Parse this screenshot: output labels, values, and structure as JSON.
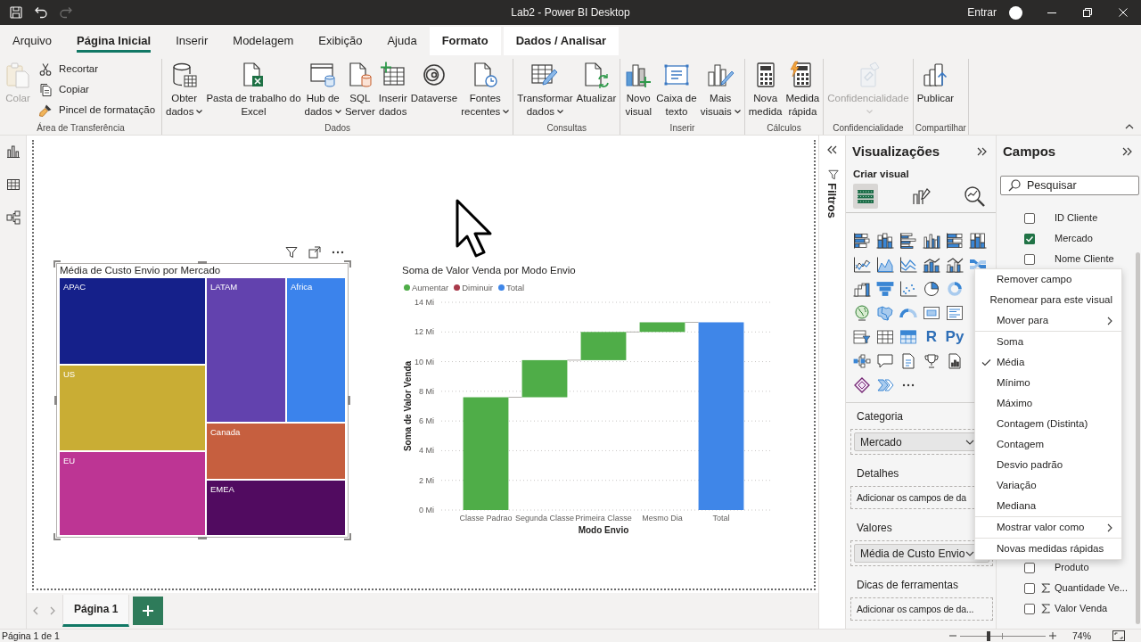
{
  "window": {
    "title": "Lab2 - Power BI Desktop",
    "sign_in": "Entrar"
  },
  "quick_access": [
    {
      "disabled": false
    },
    {
      "disabled": false
    },
    {
      "disabled": true
    }
  ],
  "menu_tabs": [
    {
      "label": "Arquivo",
      "kind": "plain",
      "selected": false
    },
    {
      "label": "Página Inicial",
      "kind": "plain",
      "selected": true
    },
    {
      "label": "Inserir",
      "kind": "plain",
      "selected": false
    },
    {
      "label": "Modelagem",
      "kind": "plain",
      "selected": false
    },
    {
      "label": "Exibição",
      "kind": "plain",
      "selected": false
    },
    {
      "label": "Ajuda",
      "kind": "plain",
      "selected": false
    },
    {
      "label": "Formato",
      "kind": "contextual",
      "selected": false
    },
    {
      "label": "Dados / Analisar",
      "kind": "contextual",
      "selected": false
    }
  ],
  "ribbon": {
    "groups": [
      {
        "label": "Área de Transferência",
        "buttons": [
          {
            "kind": "large",
            "lines": [
              "Colar"
            ],
            "dropdown": false,
            "disabled": true
          },
          {
            "kind": "small",
            "lines": [
              "Recortar"
            ],
            "dropdown": false,
            "disabled": false
          },
          {
            "kind": "small",
            "lines": [
              "Copiar"
            ],
            "dropdown": false,
            "disabled": false
          },
          {
            "kind": "small",
            "lines": [
              "Pincel de formatação"
            ],
            "dropdown": false,
            "disabled": false
          }
        ]
      },
      {
        "label": "Dados",
        "buttons": [
          {
            "kind": "large",
            "lines": [
              "Obter",
              "dados"
            ],
            "dropdown": true,
            "disabled": false
          },
          {
            "kind": "large",
            "lines": [
              "Pasta de trabalho do",
              "Excel"
            ],
            "dropdown": false,
            "disabled": false
          },
          {
            "kind": "large",
            "lines": [
              "Hub de",
              "dados"
            ],
            "dropdown": true,
            "disabled": false
          },
          {
            "kind": "large",
            "lines": [
              "SQL",
              "Server"
            ],
            "dropdown": false,
            "disabled": false
          },
          {
            "kind": "large",
            "lines": [
              "Inserir",
              "dados"
            ],
            "dropdown": false,
            "disabled": false
          },
          {
            "kind": "large",
            "lines": [
              "Dataverse"
            ],
            "dropdown": false,
            "disabled": false
          },
          {
            "kind": "large",
            "lines": [
              "Fontes",
              "recentes"
            ],
            "dropdown": true,
            "disabled": false
          }
        ]
      },
      {
        "label": "Consultas",
        "buttons": [
          {
            "kind": "large",
            "lines": [
              "Transformar",
              "dados"
            ],
            "dropdown": true,
            "disabled": false
          },
          {
            "kind": "large",
            "lines": [
              "Atualizar"
            ],
            "dropdown": false,
            "disabled": false
          }
        ]
      },
      {
        "label": "Inserir",
        "buttons": [
          {
            "kind": "large",
            "lines": [
              "Novo",
              "visual"
            ],
            "dropdown": false,
            "disabled": false
          },
          {
            "kind": "large",
            "lines": [
              "Caixa de",
              "texto"
            ],
            "dropdown": false,
            "disabled": false
          },
          {
            "kind": "large",
            "lines": [
              "Mais",
              "visuais"
            ],
            "dropdown": true,
            "disabled": false
          }
        ]
      },
      {
        "label": "Cálculos",
        "buttons": [
          {
            "kind": "large",
            "lines": [
              "Nova",
              "medida"
            ],
            "dropdown": false,
            "disabled": false
          },
          {
            "kind": "large",
            "lines": [
              "Medida",
              "rápida"
            ],
            "dropdown": false,
            "disabled": false
          }
        ]
      },
      {
        "label": "Confidencialidade",
        "buttons": [
          {
            "kind": "large",
            "lines": [
              "Confidencialidade"
            ],
            "dropdown": true,
            "disabled": true
          }
        ]
      },
      {
        "label": "Compartilhar",
        "buttons": [
          {
            "kind": "large",
            "lines": [
              "Publicar"
            ],
            "dropdown": false,
            "disabled": false
          }
        ]
      }
    ]
  },
  "report": {
    "visuals": [
      {
        "kind": "treemap",
        "selected": true,
        "title": "Média de Custo Envio por Mercado",
        "tiles": [
          {
            "label": "APAC",
            "color": "#15208a"
          },
          {
            "label": "US",
            "color": "#c9ad34"
          },
          {
            "label": "EU",
            "color": "#bd3594"
          },
          {
            "label": "LATAM",
            "color": "#6242ae"
          },
          {
            "label": "Africa",
            "color": "#3b83ec"
          },
          {
            "label": "Canada",
            "color": "#c65f3f"
          },
          {
            "label": "EMEA",
            "color": "#510b60"
          }
        ]
      },
      {
        "kind": "waterfall",
        "selected": false,
        "chart_data": {
          "type": "candlestick",
          "title": "Soma de Valor Venda por Modo Envio",
          "xlabel": "Modo Envio",
          "ylabel": "Soma de Valor Venda",
          "categories": [
            "Classe Padrao",
            "Segunda Classe",
            "Primeira Classe",
            "Mesmo Dia",
            "Total"
          ],
          "grid": true,
          "series": [
            {
              "name": "Aumentar",
              "color": "#4fad48",
              "ohlc": [
                [
                  0,
                  7.6,
                  0,
                  7.6
                ],
                [
                  7.6,
                  10.1,
                  7.6,
                  10.1
                ],
                [
                  10.1,
                  12,
                  10.1,
                  12
                ],
                [
                  12,
                  12.65,
                  12,
                  12.65
                ],
                null
              ]
            },
            {
              "name": "Diminuir",
              "color": "#a83a4a",
              "ohlc": [
                null,
                null,
                null,
                null,
                null
              ]
            },
            {
              "name": "Total",
              "color": "#3f86e8",
              "ohlc": [
                null,
                null,
                null,
                null,
                [
                  0,
                  12.65,
                  0,
                  12.65
                ]
              ]
            }
          ],
          "ylim": [
            0,
            14
          ],
          "yticks": [
            {
              "value": 0,
              "label": "0 Mi"
            },
            {
              "value": 2,
              "label": "2 Mi"
            },
            {
              "value": 4,
              "label": "4 Mi"
            },
            {
              "value": 6,
              "label": "6 Mi"
            },
            {
              "value": 8,
              "label": "8 Mi"
            },
            {
              "value": 10,
              "label": "10 Mi"
            },
            {
              "value": 12,
              "label": "12 Mi"
            },
            {
              "value": 14,
              "label": "14 Mi"
            }
          ]
        }
      }
    ]
  },
  "page_tabs": [
    {
      "label": "Página 1",
      "selected": true
    }
  ],
  "filters_pane": {
    "label": "Filtros"
  },
  "visualizations": {
    "title": "Visualizações",
    "subtitle": "Criar visual",
    "modes": [
      {
        "selected": true
      },
      {
        "selected": false
      },
      {
        "selected": false
      }
    ],
    "script_visual_labels": [
      "R",
      "Py"
    ],
    "wells": [
      {
        "label": "Categoria",
        "kind": "filled",
        "field": "Mercado"
      },
      {
        "label": "Detalhes",
        "kind": "empty",
        "placeholder": "Adicionar os campos de da"
      },
      {
        "label": "Valores",
        "kind": "filled",
        "field": "Média de Custo Envio"
      },
      {
        "label": "Dicas de ferramentas",
        "kind": "empty",
        "placeholder": "Adicionar os campos de da..."
      }
    ]
  },
  "fields": {
    "title": "Campos",
    "search": {
      "placeholder": "Pesquisar"
    },
    "items": [
      {
        "label": "ID Cliente",
        "kind": "column",
        "checked": false
      },
      {
        "label": "Mercado",
        "kind": "column",
        "checked": true
      },
      {
        "label": "Nome Cliente",
        "kind": "column",
        "checked": false
      }
    ],
    "more_items": [
      {
        "label": "Produto",
        "kind": "column",
        "checked": false
      },
      {
        "label": "Quantidade Ve...",
        "kind": "measure",
        "checked": false
      },
      {
        "label": "Valor Venda",
        "kind": "measure",
        "checked": false
      }
    ]
  },
  "context_menu": {
    "items": [
      {
        "kind": "action",
        "label": "Remover campo",
        "checked": false,
        "submenu": false
      },
      {
        "kind": "action",
        "label": "Renomear para este visual",
        "checked": false,
        "submenu": false
      },
      {
        "kind": "action",
        "label": "Mover para",
        "checked": false,
        "submenu": true
      },
      {
        "kind": "separator"
      },
      {
        "kind": "action",
        "label": "Soma",
        "checked": false,
        "submenu": false
      },
      {
        "kind": "action",
        "label": "Média",
        "checked": true,
        "submenu": false
      },
      {
        "kind": "action",
        "label": "Mínimo",
        "checked": false,
        "submenu": false
      },
      {
        "kind": "action",
        "label": "Máximo",
        "checked": false,
        "submenu": false
      },
      {
        "kind": "action",
        "label": "Contagem (Distinta)",
        "checked": false,
        "submenu": false
      },
      {
        "kind": "action",
        "label": "Contagem",
        "checked": false,
        "submenu": false
      },
      {
        "kind": "action",
        "label": "Desvio padrão",
        "checked": false,
        "submenu": false
      },
      {
        "kind": "action",
        "label": "Variação",
        "checked": false,
        "submenu": false
      },
      {
        "kind": "action",
        "label": "Mediana",
        "checked": false,
        "submenu": false
      },
      {
        "kind": "separator"
      },
      {
        "kind": "action",
        "label": "Mostrar valor como",
        "checked": false,
        "submenu": true
      },
      {
        "kind": "separator"
      },
      {
        "kind": "action",
        "label": "Novas medidas rápidas",
        "checked": false,
        "submenu": false
      }
    ]
  },
  "status_bar": {
    "page_info": "Página 1 de 1",
    "zoom": {
      "level": 0.33,
      "reading": "74%"
    }
  }
}
